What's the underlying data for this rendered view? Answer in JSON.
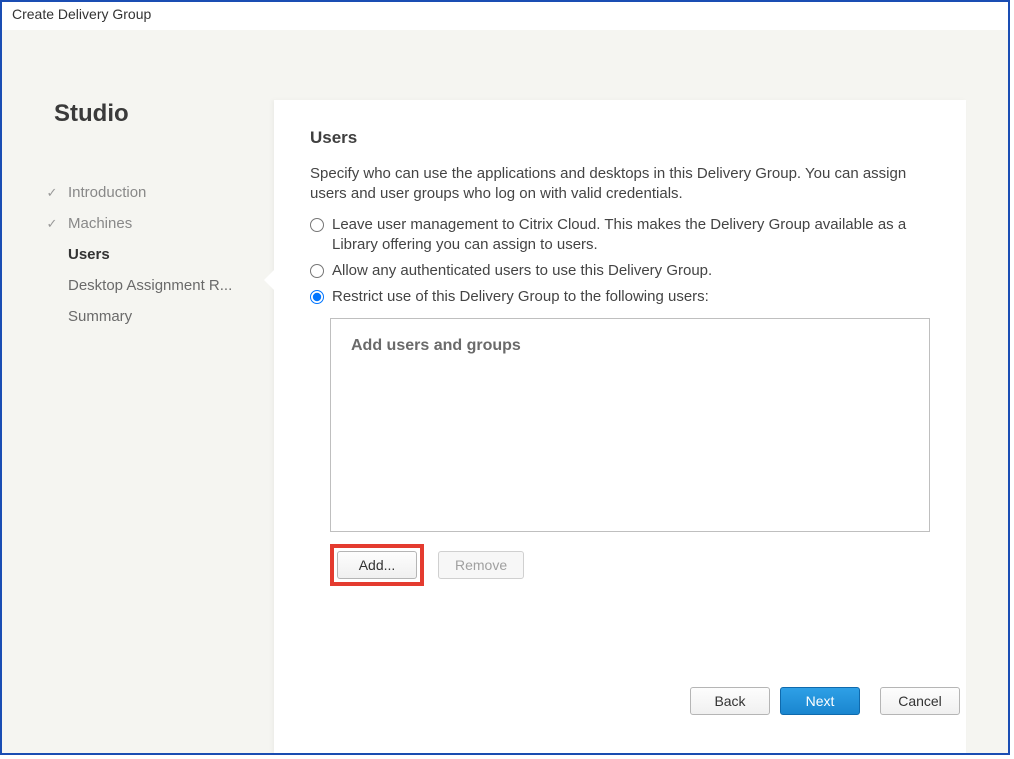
{
  "window": {
    "title": "Create Delivery Group"
  },
  "sidebar": {
    "title": "Studio",
    "steps": [
      {
        "label": "Introduction",
        "state": "done"
      },
      {
        "label": "Machines",
        "state": "done"
      },
      {
        "label": "Users",
        "state": "current"
      },
      {
        "label": "Desktop Assignment R...",
        "state": "future"
      },
      {
        "label": "Summary",
        "state": "future"
      }
    ]
  },
  "main": {
    "heading": "Users",
    "description": "Specify who can use the applications and desktops in this Delivery Group. You can assign users and user groups who log on with valid credentials.",
    "options": [
      {
        "id": "opt-cloud",
        "label": "Leave user management to Citrix Cloud. This makes the Delivery Group available as a Library offering you can assign to users.",
        "selected": false
      },
      {
        "id": "opt-any",
        "label": "Allow any authenticated users to use this Delivery Group.",
        "selected": false
      },
      {
        "id": "opt-restrict",
        "label": "Restrict use of this Delivery Group to the following users:",
        "selected": true
      }
    ],
    "userList": {
      "placeholder": "Add users and groups"
    },
    "listButtons": {
      "add": "Add...",
      "remove": "Remove"
    }
  },
  "footer": {
    "back": "Back",
    "next": "Next",
    "cancel": "Cancel"
  }
}
